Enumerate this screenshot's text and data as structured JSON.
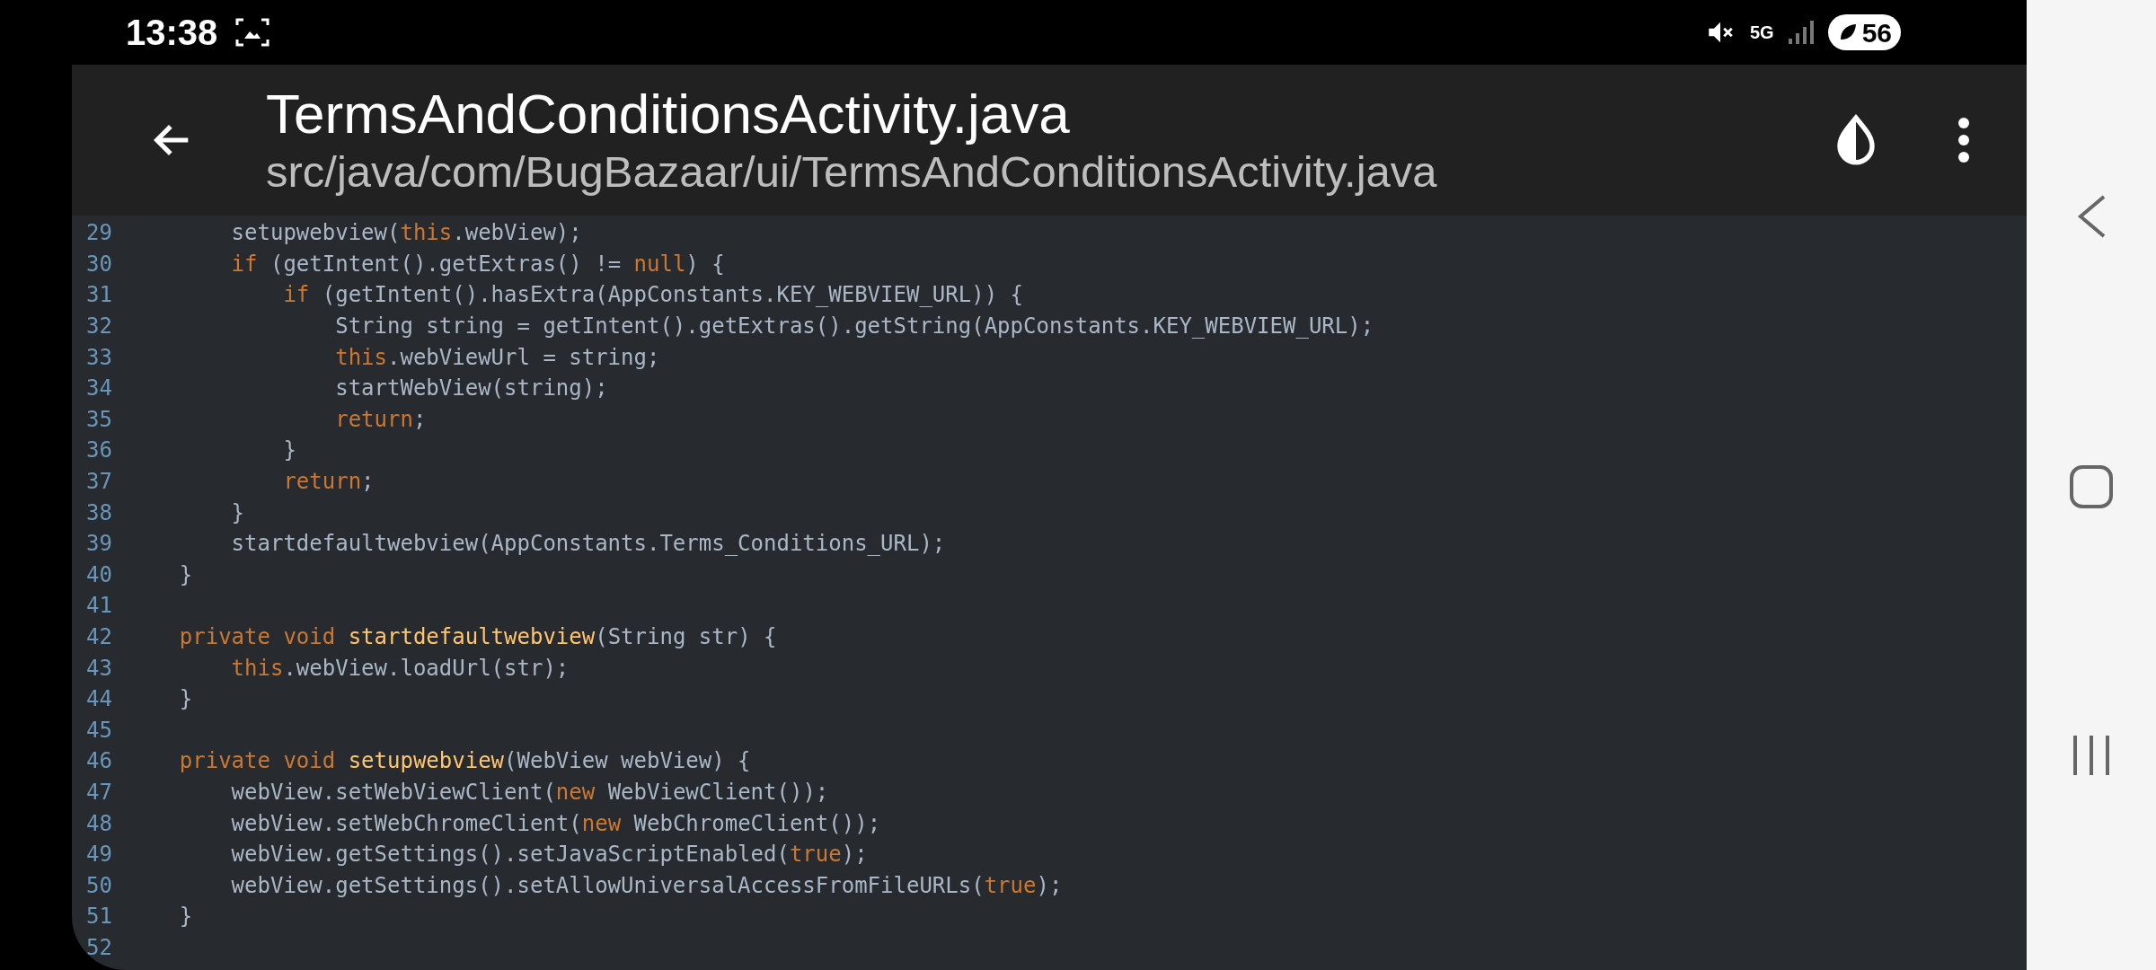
{
  "status_bar": {
    "time": "13:38",
    "network": "5G",
    "battery": "56"
  },
  "header": {
    "title": "TermsAndConditionsActivity.java",
    "subtitle": "src/java/com/BugBazaar/ui/TermsAndConditionsActivity.java"
  },
  "code": {
    "lines": [
      {
        "number": "29",
        "tokens": [
          {
            "kind": "plain",
            "text": "        setupwebview("
          },
          {
            "kind": "keyword",
            "text": "this"
          },
          {
            "kind": "plain",
            "text": ".webView);"
          }
        ]
      },
      {
        "number": "30",
        "tokens": [
          {
            "kind": "keyword",
            "text": "        if"
          },
          {
            "kind": "plain",
            "text": " (getIntent().getExtras() != "
          },
          {
            "kind": "keyword",
            "text": "null"
          },
          {
            "kind": "plain",
            "text": ") {"
          }
        ]
      },
      {
        "number": "31",
        "tokens": [
          {
            "kind": "keyword",
            "text": "            if"
          },
          {
            "kind": "plain",
            "text": " (getIntent().hasExtra(AppConstants.KEY_WEBVIEW_URL)) {"
          }
        ]
      },
      {
        "number": "32",
        "tokens": [
          {
            "kind": "plain",
            "text": "                String string = getIntent().getExtras().getString(AppConstants.KEY_WEBVIEW_URL);"
          }
        ]
      },
      {
        "number": "33",
        "tokens": [
          {
            "kind": "keyword",
            "text": "                this"
          },
          {
            "kind": "plain",
            "text": ".webViewUrl = string;"
          }
        ]
      },
      {
        "number": "34",
        "tokens": [
          {
            "kind": "plain",
            "text": "                startWebView(string);"
          }
        ]
      },
      {
        "number": "35",
        "tokens": [
          {
            "kind": "keyword",
            "text": "                return"
          },
          {
            "kind": "plain",
            "text": ";"
          }
        ]
      },
      {
        "number": "36",
        "tokens": [
          {
            "kind": "plain",
            "text": "            }"
          }
        ]
      },
      {
        "number": "37",
        "tokens": [
          {
            "kind": "keyword",
            "text": "            return"
          },
          {
            "kind": "plain",
            "text": ";"
          }
        ]
      },
      {
        "number": "38",
        "tokens": [
          {
            "kind": "plain",
            "text": "        }"
          }
        ]
      },
      {
        "number": "39",
        "tokens": [
          {
            "kind": "plain",
            "text": "        startdefaultwebview(AppConstants.Terms_Conditions_URL);"
          }
        ]
      },
      {
        "number": "40",
        "tokens": [
          {
            "kind": "plain",
            "text": "    }"
          }
        ]
      },
      {
        "number": "41"
      },
      {
        "number": "42",
        "tokens": [
          {
            "kind": "keyword",
            "text": "    private void "
          },
          {
            "kind": "function",
            "text": "startdefaultwebview"
          },
          {
            "kind": "plain",
            "text": "(String str) {"
          }
        ]
      },
      {
        "number": "43",
        "tokens": [
          {
            "kind": "keyword",
            "text": "        this"
          },
          {
            "kind": "plain",
            "text": ".webView.loadUrl(str);"
          }
        ]
      },
      {
        "number": "44",
        "tokens": [
          {
            "kind": "plain",
            "text": "    }"
          }
        ]
      },
      {
        "number": "45"
      },
      {
        "number": "46",
        "tokens": [
          {
            "kind": "keyword",
            "text": "    private void "
          },
          {
            "kind": "function",
            "text": "setupwebview"
          },
          {
            "kind": "plain",
            "text": "(WebView webView) {"
          }
        ]
      },
      {
        "number": "47",
        "tokens": [
          {
            "kind": "plain",
            "text": "        webView.setWebViewClient("
          },
          {
            "kind": "keyword",
            "text": "new"
          },
          {
            "kind": "plain",
            "text": " WebViewClient());"
          }
        ]
      },
      {
        "number": "48",
        "tokens": [
          {
            "kind": "plain",
            "text": "        webView.setWebChromeClient("
          },
          {
            "kind": "keyword",
            "text": "new"
          },
          {
            "kind": "plain",
            "text": " WebChromeClient());"
          }
        ]
      },
      {
        "number": "49",
        "tokens": [
          {
            "kind": "plain",
            "text": "        webView.getSettings().setJavaScriptEnabled("
          },
          {
            "kind": "keyword",
            "text": "true"
          },
          {
            "kind": "plain",
            "text": ");"
          }
        ]
      },
      {
        "number": "50",
        "tokens": [
          {
            "kind": "plain",
            "text": "        webView.getSettings().setAllowUniversalAccessFromFileURLs("
          },
          {
            "kind": "keyword",
            "text": "true"
          },
          {
            "kind": "plain",
            "text": ");"
          }
        ]
      },
      {
        "number": "51",
        "tokens": [
          {
            "kind": "plain",
            "text": "    }"
          }
        ]
      },
      {
        "number": "52"
      }
    ]
  }
}
